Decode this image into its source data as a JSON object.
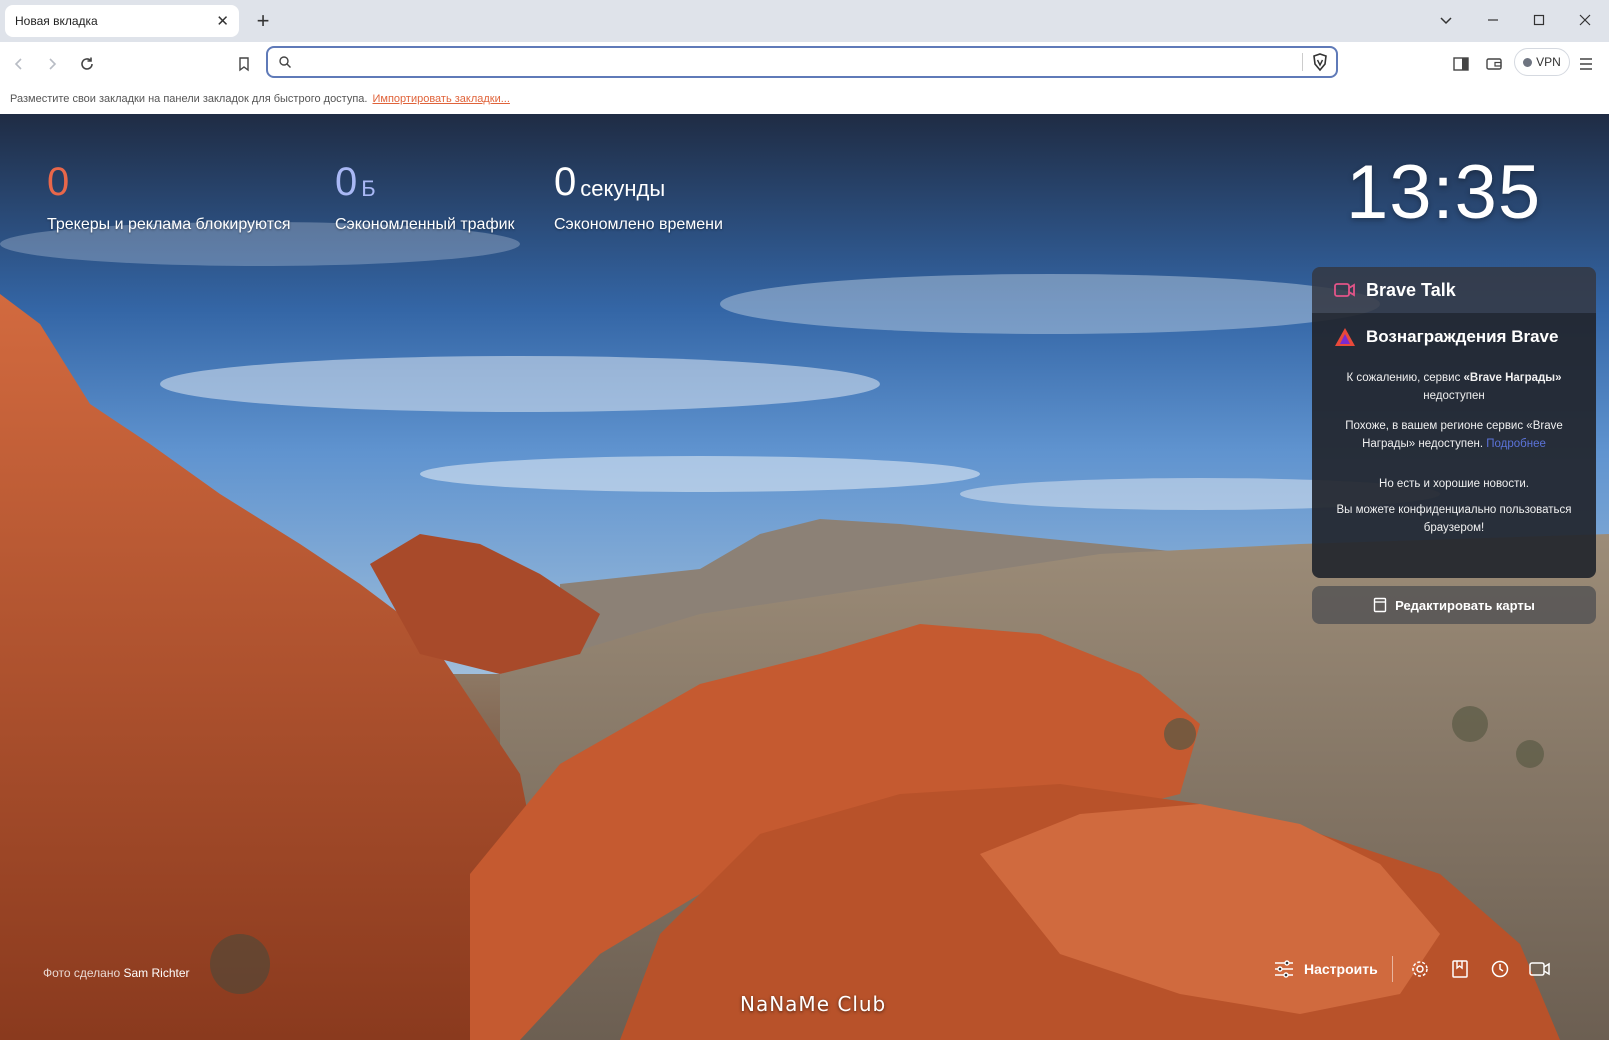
{
  "tab": {
    "title": "Новая вкладка",
    "close_icon": "close-icon"
  },
  "window": {
    "controls": [
      "chevron-down-icon",
      "minimize-icon",
      "maximize-icon",
      "close-icon"
    ]
  },
  "toolbar": {
    "address_value": "",
    "vpn_label": "VPN"
  },
  "bookmarks_bar": {
    "hint": "Разместите свои закладки на панели закладок для быстрого доступа.",
    "import_link": "Импортировать закладки..."
  },
  "stats": {
    "trackers": {
      "value": "0",
      "label": "Трекеры и реклама блокируются",
      "color": "#e8674a"
    },
    "bandwidth": {
      "value": "0",
      "unit": "Б",
      "label": "Сэкономленный трафик",
      "color": "#a9b8f5"
    },
    "time": {
      "value": "0",
      "unit": "секунды",
      "label": "Сэкономлено времени",
      "color": "#ffffff"
    }
  },
  "clock": "13:35",
  "widgets": {
    "talk": {
      "title": "Brave Talk"
    },
    "rewards": {
      "title": "Вознаграждения Brave",
      "p1_prefix": "К сожалению, сервис ",
      "p1_bold": "«Brave Награды»",
      "p1_suffix": " недоступен",
      "p2": "Похоже, в вашем регионе сервис «Brave Награды» недоступен.",
      "p2_link": "Подробнее",
      "p3": "Но есть и хорошие новости.",
      "p4": "Вы можете конфиденциально пользоваться браузером!"
    },
    "edit_cards": "Редактировать карты"
  },
  "photo_credit": {
    "prefix": "Фото сделано",
    "author": "Sam Richter"
  },
  "bottom": {
    "customize": "Настроить"
  },
  "watermark": "NaNaMe Club",
  "colors": {
    "accent": "#5f7ab8",
    "link": "#e0633a",
    "brand": "#fb542b"
  }
}
